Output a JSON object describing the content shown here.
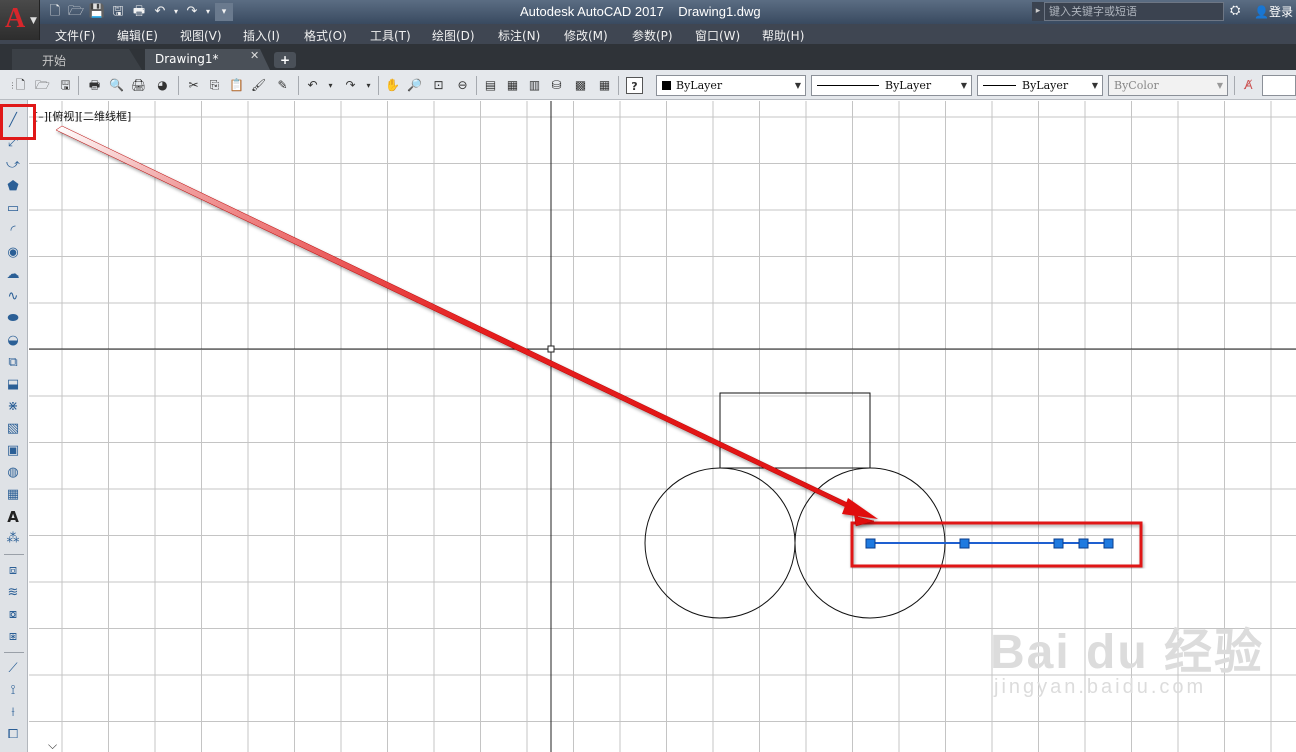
{
  "app": {
    "logo_letter": "A",
    "title": "Autodesk AutoCAD 2017    Drawing1.dwg",
    "search_placeholder": "键入关键字或短语",
    "login_label": "登录"
  },
  "quick_access": [
    "new-icon",
    "open-icon",
    "save-icon",
    "saveas-icon",
    "plot-icon",
    "undo-icon",
    "redo-icon",
    "customize-icon"
  ],
  "menu": [
    "文件(F)",
    "编辑(E)",
    "视图(V)",
    "插入(I)",
    "格式(O)",
    "工具(T)",
    "绘图(D)",
    "标注(N)",
    "修改(M)",
    "参数(P)",
    "窗口(W)",
    "帮助(H)"
  ],
  "tabs": {
    "start": "开始",
    "drawing": "Drawing1*",
    "close": "✕",
    "add": "+"
  },
  "toolbar": {
    "color_combo": "ByLayer",
    "linetype_combo": "ByLayer",
    "lineweight_combo": "ByLayer",
    "plotstyle_combo": "ByColor"
  },
  "viewport": {
    "label": "[–][俯视][二维线框]"
  },
  "colors": {
    "highlight": "#e01818",
    "selection": "#1e5fd0",
    "grip": "#1f7ae0"
  },
  "watermark": {
    "brand": "Bai du 经验",
    "url": "jingyan.baidu.com"
  }
}
